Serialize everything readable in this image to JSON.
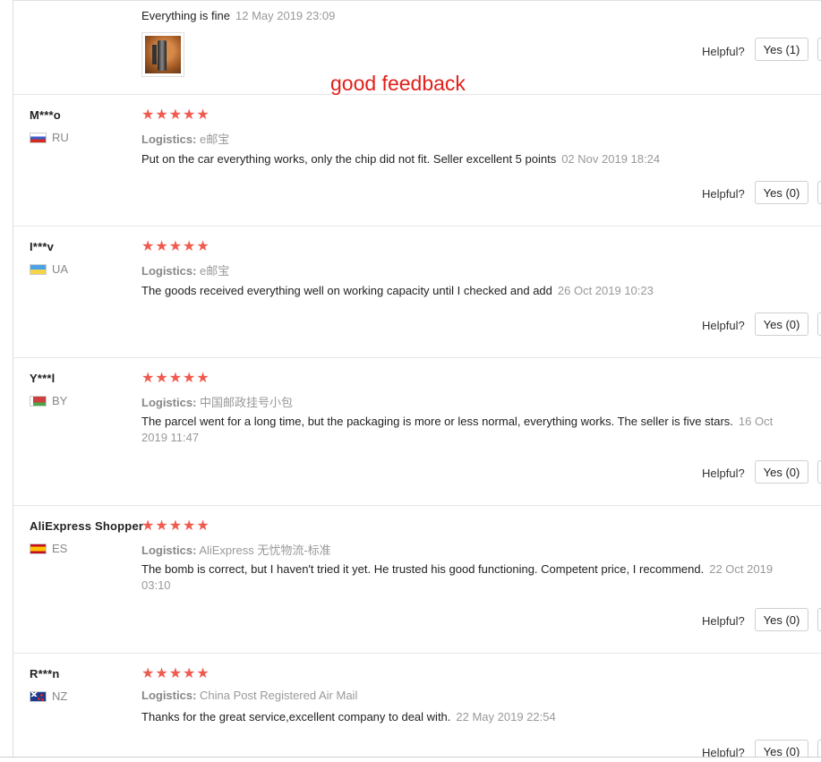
{
  "annotation": "good feedback",
  "helpful_label": "Helpful?",
  "logistics_label": "Logistics:",
  "stars": "★★★★★",
  "top_review": {
    "text": "Everything is fine",
    "date": "12 May 2019 23:09",
    "yes_label": "Yes (1)"
  },
  "reviews": [
    {
      "user": "M***o",
      "country": "RU",
      "logistics": "e邮宝",
      "text": "Put on the car everything works, only the chip did not fit. Seller excellent 5 points",
      "date": "02 Nov 2019 18:24",
      "yes_label": "Yes (0)"
    },
    {
      "user": "I***v",
      "country": "UA",
      "logistics": "e邮宝",
      "text": "The goods received everything well on working capacity until I checked and add",
      "date": "26 Oct 2019 10:23",
      "yes_label": "Yes (0)"
    },
    {
      "user": "Y***l",
      "country": "BY",
      "logistics": "中国邮政挂号小包",
      "text": "The parcel went for a long time, but the packaging is more or less normal, everything works. The seller is five stars.",
      "date": "16 Oct 2019 11:47",
      "yes_label": "Yes (0)"
    },
    {
      "user": "AliExpress Shopper",
      "country": "ES",
      "logistics": "AliExpress 无忧物流-标准",
      "text": "The bomb is correct, but I haven't tried it yet. He trusted his good functioning. Competent price, I recommend.",
      "date": "22 Oct 2019 03:10",
      "yes_label": "Yes (0)"
    },
    {
      "user": "R***n",
      "country": "NZ",
      "logistics": "China Post Registered Air Mail",
      "text": "Thanks for the great service,excellent company to deal with.",
      "date": "22 May 2019 22:54",
      "yes_label": "Yes (0)"
    }
  ]
}
